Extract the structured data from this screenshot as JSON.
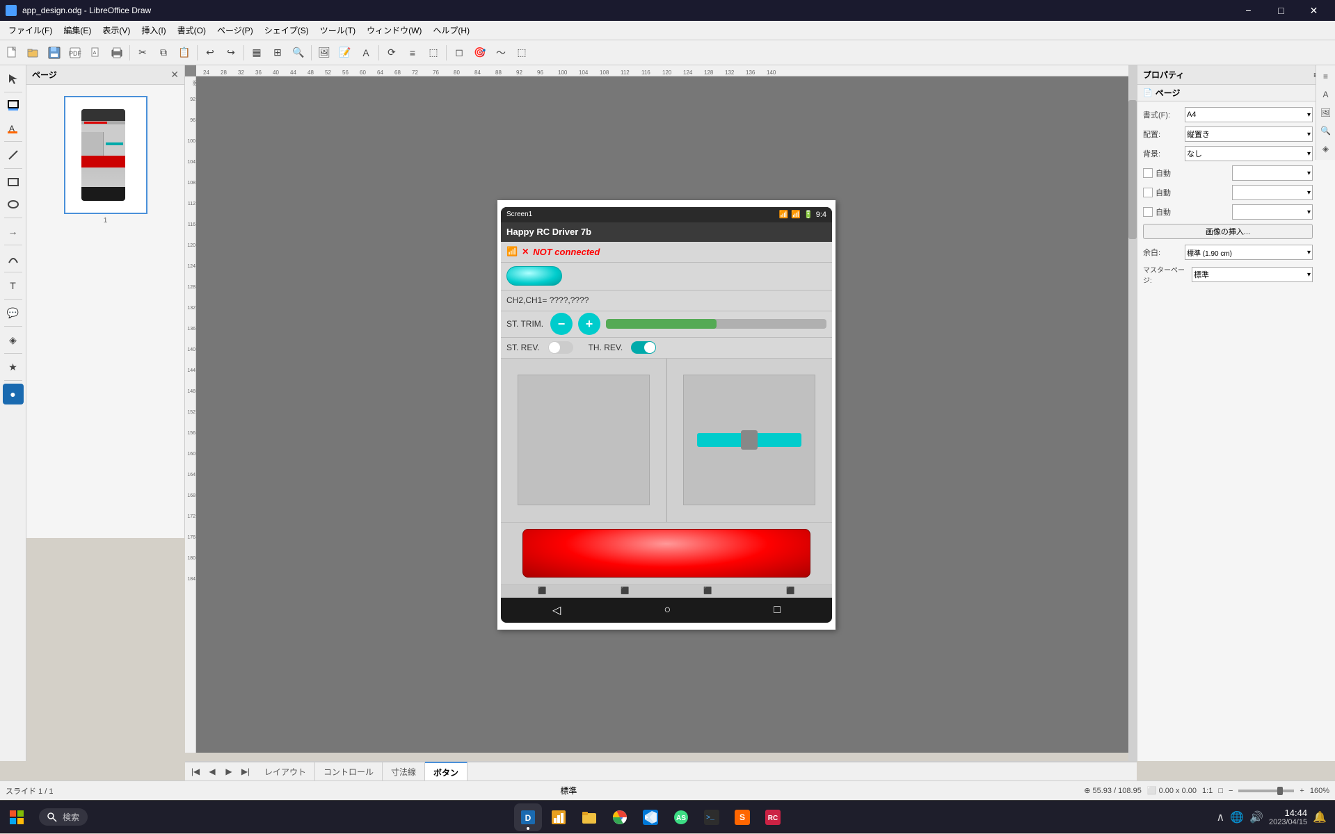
{
  "titlebar": {
    "title": "app_design.odg - LibreOffice Draw",
    "minimize": "−",
    "maximize": "□",
    "close": "✕"
  },
  "menu": {
    "items": [
      "ファイル(F)",
      "編集(E)",
      "表示(V)",
      "挿入(I)",
      "書式(O)",
      "ページ(P)",
      "シェイプ(S)",
      "ツール(T)",
      "ウィンドウ(W)",
      "ヘルプ(H)"
    ]
  },
  "pages_panel": {
    "title": "ページ",
    "close": "✕",
    "page_number": "1"
  },
  "properties_panel": {
    "title": "プロパティ",
    "close": "✕",
    "sub_title": "ページ",
    "format_label": "書式(F):",
    "format_value": "A4",
    "layout_label": "配置:",
    "layout_value": "縦置き",
    "bg_label": "背景:",
    "bg_value": "なし",
    "checkbox1_label": "自動",
    "checkbox2_label": "自動",
    "checkbox3_label": "自動",
    "insert_image_btn": "画像の挿入...",
    "margin_label": "余白:",
    "margin_value": "標準 (1.90 cm)",
    "master_page_label": "マスターページ:",
    "master_page_value": "標準"
  },
  "phone": {
    "screen_label": "Screen1",
    "app_title": "Happy RC Driver 7b",
    "status_icons": "📶 🔋 9:4",
    "not_connected_text": "NOT connected",
    "ch_text": "CH2,CH1=    ????,????",
    "st_trim_label": "ST. TRIM.",
    "trim_minus": "−",
    "trim_plus": "+",
    "st_rev_label": "ST. REV.",
    "th_rev_label": "TH. REV."
  },
  "bottom_tabs": {
    "tabs": [
      "レイアウト",
      "コントロール",
      "寸法線",
      "ボタン"
    ]
  },
  "status_bar": {
    "left": "スライド 1 / 1",
    "center": "標準",
    "coords": "55.93 / 108.95",
    "size": "0.00 x 0.00",
    "zoom_ratio": "1:1",
    "zoom_percent": "160%"
  },
  "taskbar": {
    "search_text": "検索",
    "time": "14:44",
    "date": "2023/04/15"
  },
  "toolbar_buttons": [
    "🆕",
    "📂",
    "💾",
    "📄",
    "📤",
    "🖨",
    "|",
    "✂",
    "📋",
    "📋",
    "|",
    "↩",
    "↪",
    "|",
    "▦",
    "▦",
    "🔍",
    "|",
    "🖼",
    "📝",
    "🔗",
    "|",
    "T",
    "|",
    "✏",
    "|",
    "⬚",
    "|",
    "🖱",
    "💡",
    "☐",
    "⬚"
  ]
}
